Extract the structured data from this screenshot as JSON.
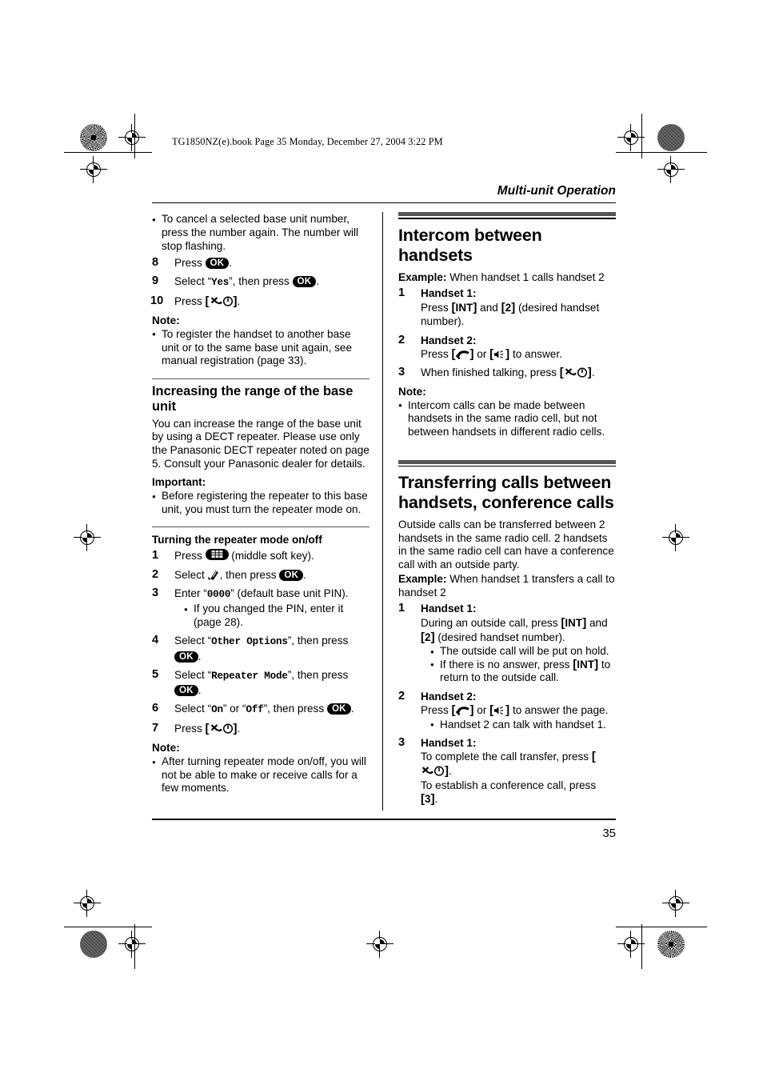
{
  "page": {
    "book_line": "TG1850NZ(e).book  Page 35  Monday, December 27, 2004  3:22 PM",
    "running_head": "Multi-unit Operation",
    "page_number": "35",
    "rule_color": "#555555"
  },
  "left_column": {
    "top_bullets": [
      "To cancel a selected base unit number, press the number again. The number will stop flashing."
    ],
    "steps": [
      {
        "num": "8",
        "pre": "Press ",
        "icon": "ok-button",
        "post": "."
      },
      {
        "num": "9",
        "pre": "Select ",
        "quoted": "Yes",
        "mid": ", then press ",
        "icon": "ok-button",
        "post": "."
      },
      {
        "num": "10",
        "pre": "Press ",
        "icon": "power-off-key",
        "post": "."
      }
    ],
    "note_label": "Note:",
    "note_bullets": [
      "To register the handset to another base unit or to the same base unit again, see manual registration (page 33)."
    ],
    "section": {
      "title": "Increasing the range of the base unit",
      "body": "You can increase the range of the base unit by using a DECT repeater. Please use only the Panasonic DECT repeater noted on page 5. Consult your Panasonic dealer for details.",
      "important_label": "Important:",
      "important_bullets": [
        "Before registering the repeater to this base unit, you must turn the repeater mode on."
      ],
      "subsection_title": "Turning the repeater mode on/off",
      "steps": [
        {
          "num": "1",
          "pre": "Press ",
          "icon": "middle-soft-key",
          "post": " (middle soft key)."
        },
        {
          "num": "2",
          "pre": "Select ",
          "icon": "settings-wedge",
          "mid": ", then press ",
          "icon2": "ok-button",
          "post": "."
        },
        {
          "num": "3",
          "pre": "Enter ",
          "quoted": "0000",
          "post": " (default base unit PIN).",
          "sub_bullets": [
            "If you changed the PIN, enter it (page 28)."
          ]
        },
        {
          "num": "4",
          "pre": "Select ",
          "quoted": "Other Options",
          "mid": ", then press ",
          "icon": "ok-button",
          "post": "."
        },
        {
          "num": "5",
          "pre": "Select ",
          "quoted": "Repeater Mode",
          "mid": ", then press ",
          "icon": "ok-button",
          "post": "."
        },
        {
          "num": "6",
          "pre": "Select ",
          "quoted": "On",
          "mid2": " or ",
          "quoted2": "Off",
          "mid": ", then press ",
          "icon": "ok-button",
          "post": "."
        },
        {
          "num": "7",
          "pre": "Press ",
          "icon": "power-off-key",
          "post": "."
        }
      ],
      "note_label": "Note:",
      "note_bullets": [
        "After turning repeater mode on/off, you will not be able to make or receive calls for a few moments."
      ]
    }
  },
  "right_column": {
    "section1": {
      "title": "Intercom between handsets",
      "example_label": "Example:",
      "example_text": " When handset 1 calls handset 2",
      "steps": [
        {
          "num": "1",
          "label": "Handset 1:",
          "pre": "Press ",
          "key1": "INT",
          "mid": " and ",
          "key2": "2",
          "post": " (desired handset number)."
        },
        {
          "num": "2",
          "label": "Handset 2:",
          "pre": "Press ",
          "icon": "talk-key",
          "mid": " or ",
          "icon2": "speakerphone-key",
          "post": " to answer."
        },
        {
          "num": "3",
          "pre": "When finished talking, press ",
          "icon": "power-off-key",
          "post": "."
        }
      ],
      "note_label": "Note:",
      "note_bullets": [
        "Intercom calls can be made between handsets in the same radio cell, but not between handsets in different radio cells."
      ]
    },
    "section2": {
      "title": "Transferring calls between handsets, conference calls",
      "body": "Outside calls can be transferred between 2 handsets in the same radio cell. 2 handsets in the same radio cell can have a conference call with an outside party.",
      "example_label": "Example:",
      "example_text": " When handset 1 transfers a call to handset 2",
      "steps": [
        {
          "num": "1",
          "label": "Handset 1:",
          "pre": "During an outside call, press ",
          "key1": "INT",
          "mid": " and ",
          "key2": "2",
          "post": " (desired handset number).",
          "sub_bullets_rich": [
            {
              "text": "The outside call will be put on hold."
            },
            {
              "pre": "If there is no answer, press ",
              "key": "INT",
              "post": " to return to the outside call."
            }
          ]
        },
        {
          "num": "2",
          "label": "Handset 2:",
          "pre": "Press ",
          "icon": "talk-key",
          "mid": " or ",
          "icon2": "speakerphone-key",
          "post": " to answer the page.",
          "sub_bullets": [
            "Handset 2 can talk with handset 1."
          ]
        },
        {
          "num": "3",
          "label": "Handset 1:",
          "line1_pre": "To complete the call transfer, press ",
          "line1_icon": "power-off-key",
          "line1_post": ".",
          "line2_pre": "To establish a conference call, press ",
          "line2_key": "3",
          "line2_post": "."
        }
      ]
    }
  },
  "labels": {
    "ok_button": "OK"
  }
}
